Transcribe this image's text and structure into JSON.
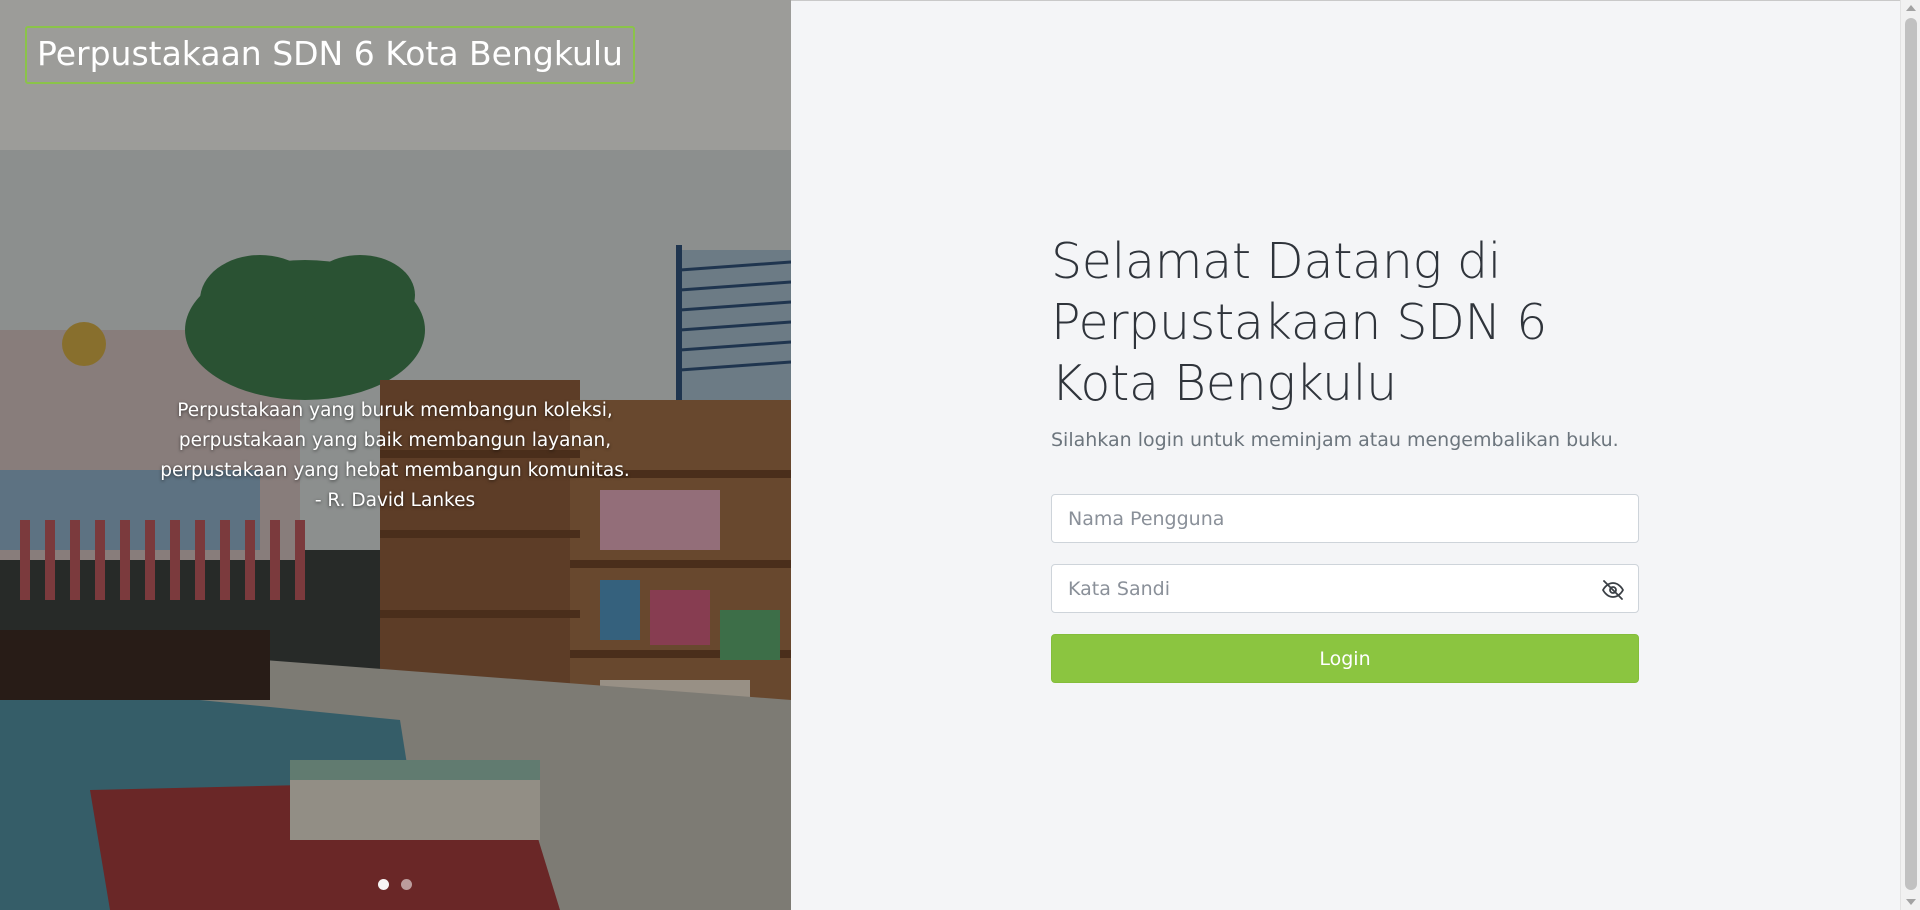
{
  "brand": {
    "title": "Perpustakaan SDN 6 Kota Bengkulu"
  },
  "carousel": {
    "quote": "Perpustakaan yang buruk membangun koleksi, perpustakaan yang baik membangun layanan, perpustakaan yang hebat membangun komunitas.",
    "author": "- R. David Lankes",
    "slide_count": 2,
    "active_slide": 1
  },
  "login": {
    "heading": "Selamat Datang di Perpustakaan SDN 6 Kota Bengkulu",
    "subtitle": "Silahkan login untuk meminjam atau mengembalikan buku.",
    "username_placeholder": "Nama Pengguna",
    "username_value": "",
    "password_placeholder": "Kata Sandi",
    "password_value": "",
    "password_toggle_icon": "eye-slash-icon",
    "submit_label": "Login"
  },
  "colors": {
    "accent": "#8bc540",
    "brand_border": "#8bc34a",
    "heading": "#2f343b",
    "muted": "#6c757d",
    "panel_bg": "#f4f5f7"
  }
}
